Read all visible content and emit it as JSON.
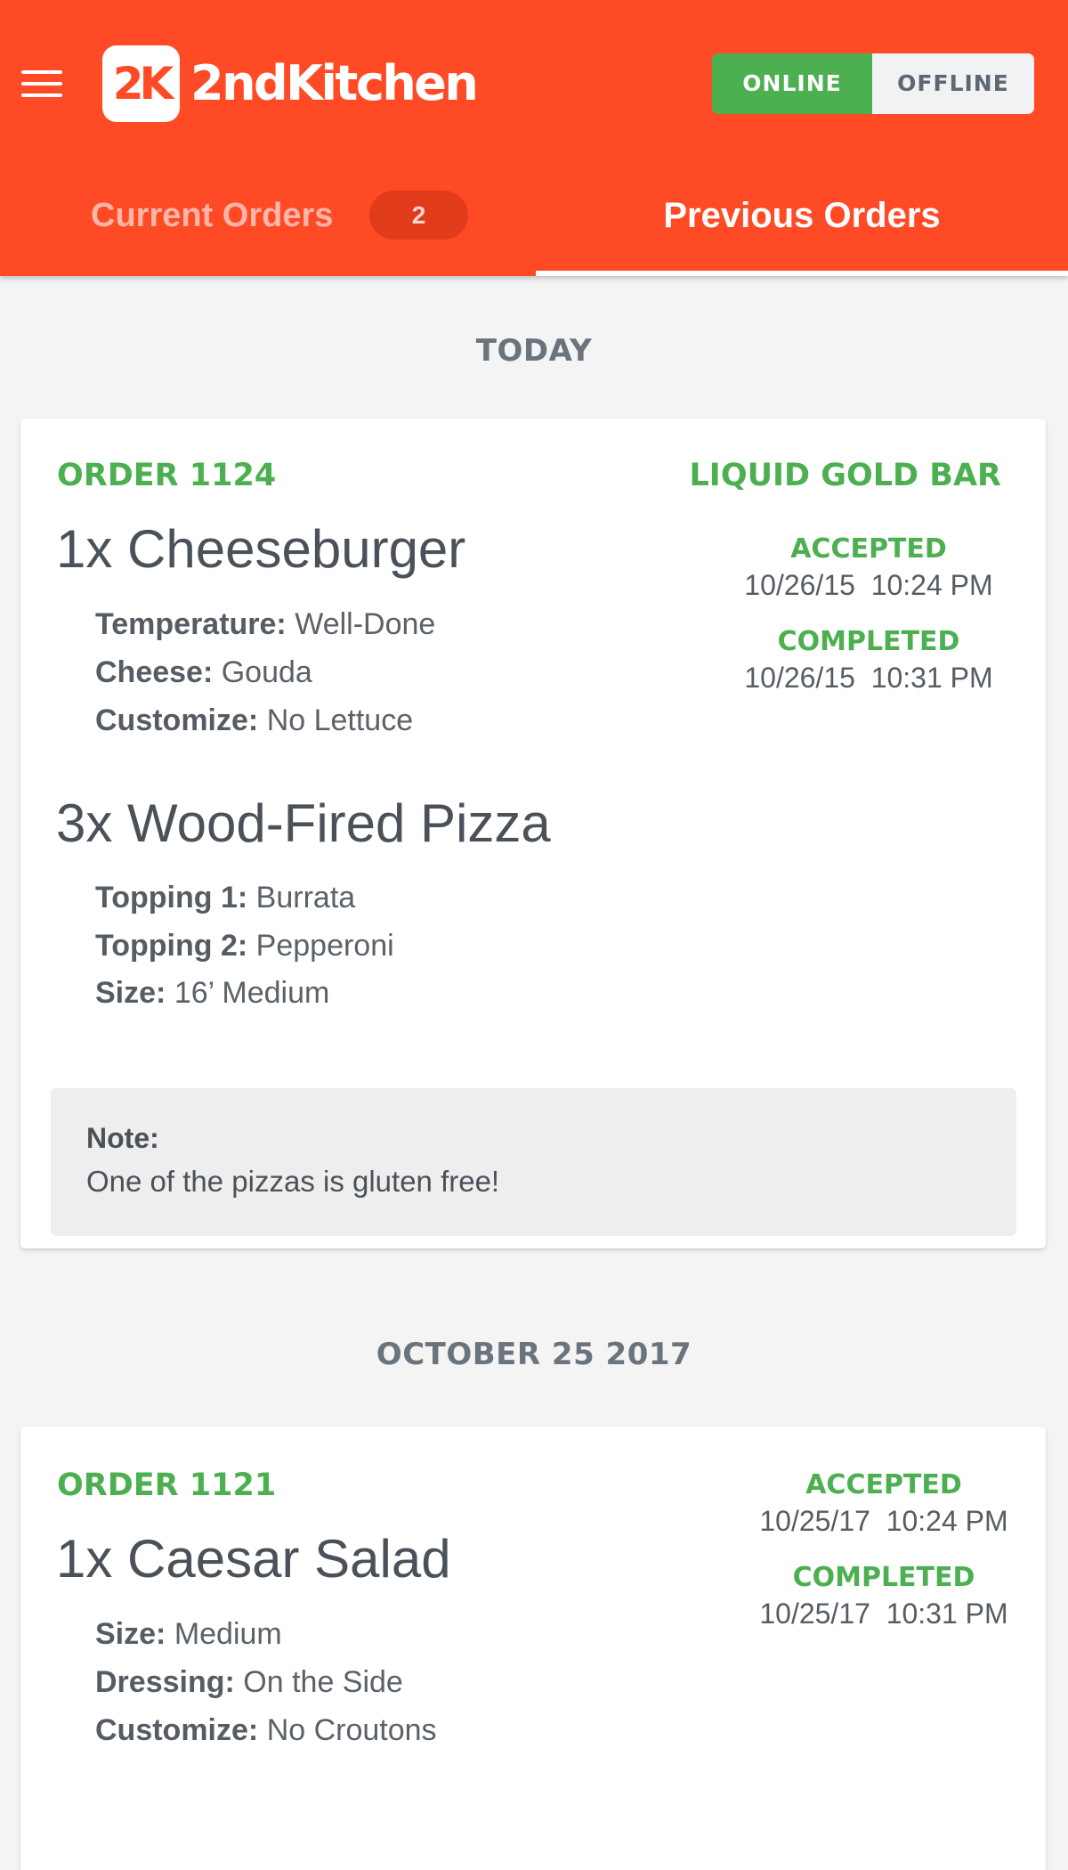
{
  "app": {
    "name": "2ndKitchen",
    "logo_mark": "2K",
    "brand_color": "#ff4a26",
    "status_green": "#4caf50"
  },
  "header": {
    "menu_icon": "hamburger-menu-icon",
    "toggle": {
      "online_label": "ONLINE",
      "offline_label": "OFFLINE",
      "selected": "ONLINE"
    }
  },
  "tabs": {
    "current": {
      "label": "Current Orders",
      "badge": "2"
    },
    "previous": {
      "label": "Previous Orders",
      "active": true
    }
  },
  "sections": [
    {
      "heading": "TODAY",
      "order": {
        "number": "ORDER 1124",
        "restaurant": "LIQUID GOLD BAR",
        "accepted": {
          "label": "ACCEPTED",
          "time": "10/26/15  10:24 PM"
        },
        "completed": {
          "label": "COMPLETED",
          "time": "10/26/15  10:31 PM"
        },
        "items": [
          {
            "title": "1x Cheeseburger",
            "options": [
              {
                "key": "Temperature:",
                "value": "Well-Done"
              },
              {
                "key": "Cheese:",
                "value": "Gouda"
              },
              {
                "key": "Customize:",
                "value": "No Lettuce"
              }
            ]
          },
          {
            "title": "3x Wood-Fired Pizza",
            "options": [
              {
                "key": "Topping 1:",
                "value": "Burrata"
              },
              {
                "key": "Topping 2:",
                "value": "Pepperoni"
              },
              {
                "key": "Size:",
                "value": "16’ Medium"
              }
            ]
          }
        ],
        "note": {
          "label": "Note:",
          "text": "One of the pizzas is gluten free!"
        }
      }
    },
    {
      "heading": "OCTOBER 25 2017",
      "order": {
        "number": "ORDER 1121",
        "accepted": {
          "label": "ACCEPTED",
          "time": "10/25/17  10:24 PM"
        },
        "completed": {
          "label": "COMPLETED",
          "time": "10/25/17  10:31 PM"
        },
        "items": [
          {
            "title": "1x Caesar Salad",
            "options": [
              {
                "key": "Size:",
                "value": "Medium"
              },
              {
                "key": "Dressing:",
                "value": "On the Side"
              },
              {
                "key": "Customize:",
                "value": "No Croutons"
              }
            ]
          }
        ]
      }
    }
  ]
}
